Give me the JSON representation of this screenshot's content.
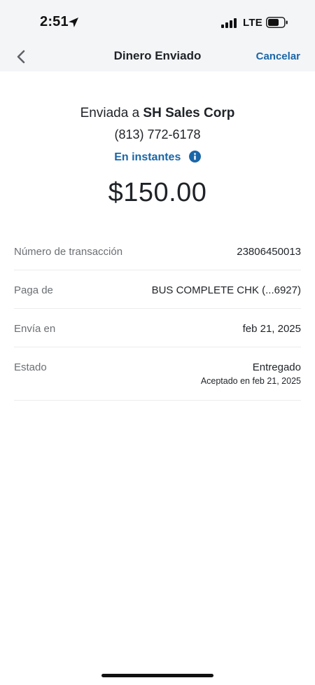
{
  "status_bar": {
    "time": "2:51",
    "network": "LTE",
    "icons": [
      "location-arrow-icon",
      "signal-bars-icon",
      "battery-icon"
    ]
  },
  "nav": {
    "title": "Dinero Enviado",
    "cancel_label": "Cancelar",
    "back_icon": "chevron-left-icon"
  },
  "summary": {
    "sent_to_prefix": "Enviada a",
    "recipient_name": "SH Sales Corp",
    "phone": "(813) 772-6178",
    "speed_label": "En instantes",
    "speed_icon": "info-icon",
    "amount": "$150.00"
  },
  "details": [
    {
      "label": "Número de transacción",
      "value": "23806450013"
    },
    {
      "label": "Paga de",
      "value": "BUS COMPLETE CHK (...6927)"
    },
    {
      "label": "Envía en",
      "value": "feb 21, 2025"
    },
    {
      "label": "Estado",
      "value": "Entregado",
      "sub": "Aceptado en feb 21, 2025"
    }
  ],
  "colors": {
    "accent": "#1a66a8",
    "header_bg": "#f4f5f7",
    "text": "#1f2328",
    "label": "#6b6f74",
    "divider": "#ececec"
  }
}
